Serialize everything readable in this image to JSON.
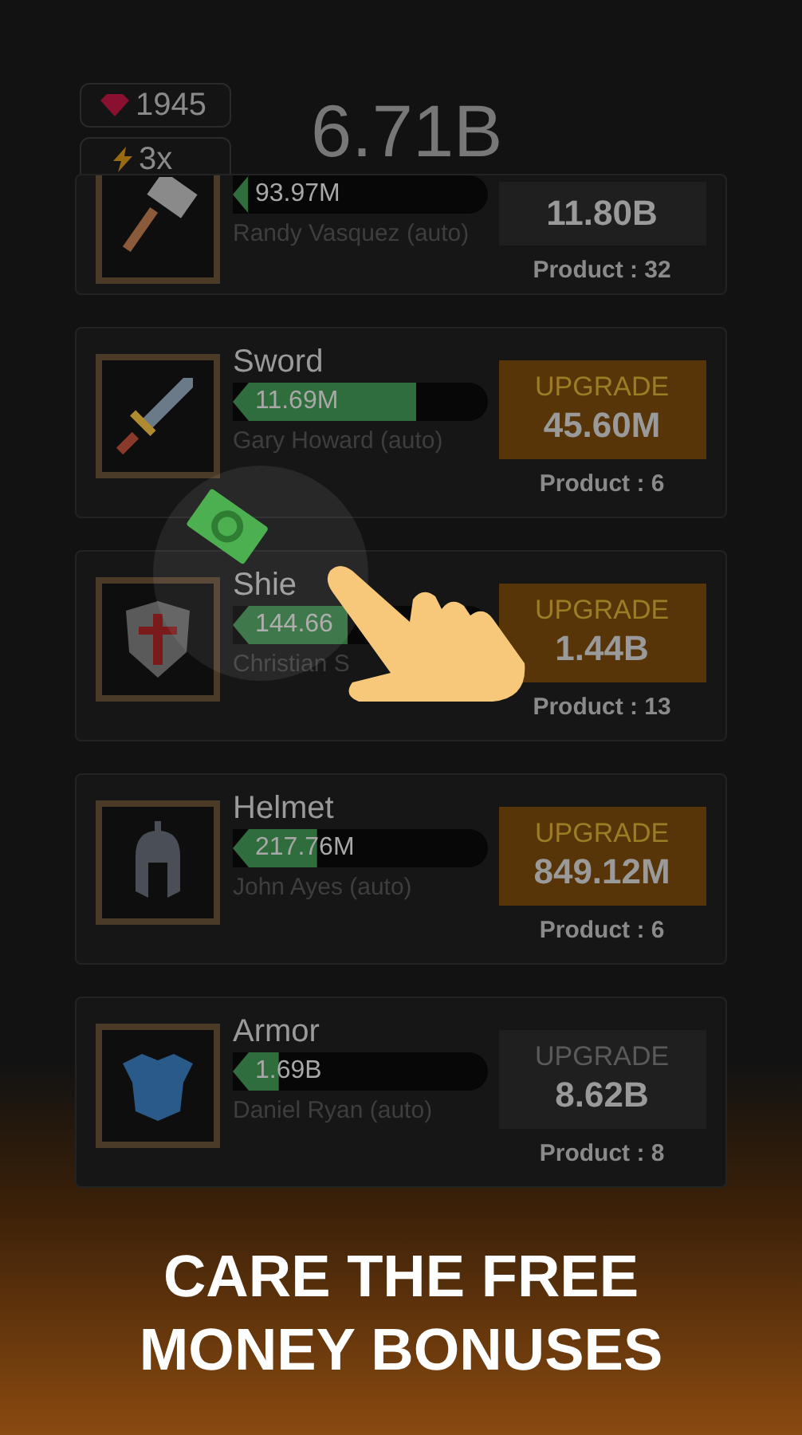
{
  "gems": "1945",
  "boost": "3x",
  "balance": "6.71B",
  "items": [
    {
      "kind": "hammer",
      "amount": "93.97M",
      "level": 0.06,
      "manager": "Randy Vasquez (auto)",
      "cost": "11.80B",
      "enabled": false,
      "product": "Product : 32"
    },
    {
      "kind": "sword",
      "name": "Sword",
      "amount": "11.69M",
      "level": 0.72,
      "manager": "Gary Howard (auto)",
      "upgrade_label": "UPGRADE",
      "cost": "45.60M",
      "enabled": true,
      "product": "Product : 6"
    },
    {
      "kind": "shield",
      "name": "Shie",
      "amount": "144.66",
      "level": 0.45,
      "manager": "Christian S",
      "upgrade_label": "UPGRADE",
      "cost": "1.44B",
      "enabled": true,
      "product": "Product : 13"
    },
    {
      "kind": "helmet",
      "name": "Helmet",
      "amount": "217.76M",
      "level": 0.33,
      "manager": "John Ayes (auto)",
      "upgrade_label": "UPGRADE",
      "cost": "849.12M",
      "enabled": true,
      "product": "Product : 6"
    },
    {
      "kind": "armor",
      "name": "Armor",
      "amount": "1.69B",
      "level": 0.18,
      "manager": "Daniel Ryan (auto)",
      "upgrade_label": "UPGRADE",
      "cost": "8.62B",
      "enabled": false,
      "product": "Product : 8"
    }
  ],
  "banner": [
    "CARE THE FREE",
    "MONEY BONUSES"
  ]
}
